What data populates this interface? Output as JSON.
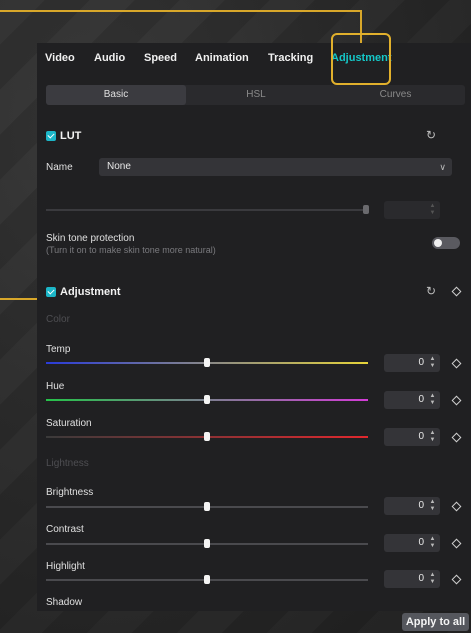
{
  "tabs": [
    "Video",
    "Audio",
    "Speed",
    "Animation",
    "Tracking",
    "Adjustment"
  ],
  "active_tab": "Adjustment",
  "subtabs": [
    "Basic",
    "HSL",
    "Curves"
  ],
  "lut": {
    "title": "LUT",
    "name_label": "Name",
    "name_value": "None",
    "skin_title": "Skin tone protection",
    "skin_desc": "(Turn it on to make skin tone more natural)"
  },
  "adjustment": {
    "title": "Adjustment",
    "color_group": "Color",
    "lightness_group": "Lightness",
    "sliders": [
      {
        "label": "Temp",
        "value": "0"
      },
      {
        "label": "Hue",
        "value": "0"
      },
      {
        "label": "Saturation",
        "value": "0"
      },
      {
        "label": "Brightness",
        "value": "0"
      },
      {
        "label": "Contrast",
        "value": "0"
      },
      {
        "label": "Highlight",
        "value": "0"
      }
    ],
    "shadow_label": "Shadow"
  },
  "apply_label": "Apply to all",
  "colors": {
    "accent": "#15c8c8",
    "highlight_frame": "#e1b02c",
    "temp_gradient": [
      "#2a3bd8",
      "#e6d43a"
    ],
    "hue_gradient": [
      "#26c24a",
      "#d23cd6"
    ],
    "saturation_gradient": [
      "#3a3a3a",
      "#e0282e"
    ]
  }
}
